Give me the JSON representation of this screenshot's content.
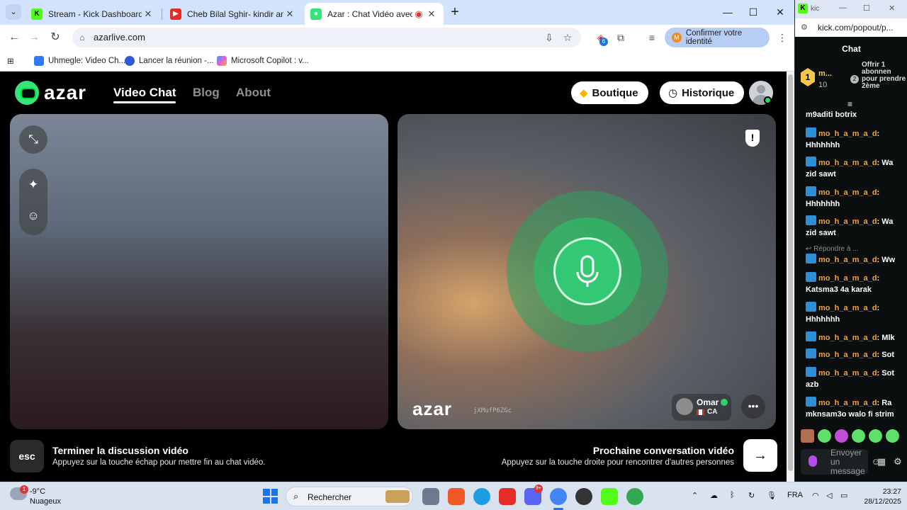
{
  "browser": {
    "tabs": [
      {
        "title": "Stream - Kick Dashboard",
        "favicon": "kick-icon",
        "color": "#53fc18"
      },
      {
        "title": "Cheb Bilal Sghir- kindir ana - Yo",
        "favicon": "youtube-icon",
        "color": "#e52d27"
      },
      {
        "title": "Azar : Chat Vidéo avec de n",
        "favicon": "azar-icon",
        "color": "#33e57b",
        "active": true
      }
    ],
    "url": "azarlive.com",
    "identity_label": "Confirmer votre identité",
    "identity_initial": "M",
    "extension_badge": "6",
    "bookmarks": [
      "Uhmegle: Video Ch...",
      "Lancer la réunion -...",
      "Microsoft Copilot : v..."
    ]
  },
  "azar": {
    "logo_text": "azar",
    "nav": [
      "Video Chat",
      "Blog",
      "About"
    ],
    "boutique_label": "Boutique",
    "historique_label": "Historique",
    "watermark": "azar",
    "watermark_code": "jXMufP6ZGc",
    "peer": {
      "name": "Omar",
      "country": "CA"
    },
    "end_title": "Terminer la discussion vidéo",
    "end_sub": "Appuyez sur la touche échap pour mettre fin au chat vidéo.",
    "esc_key": "esc",
    "next_title": "Prochaine conversation vidéo",
    "next_sub": "Appuyez sur la touche droite pour rencontrer d'autres personnes",
    "accent": "#33c873"
  },
  "kick": {
    "window_title": "kic",
    "url": "kick.com/popout/p...",
    "header": "Chat",
    "gift": {
      "rank": "1",
      "name": "m...",
      "count": "10",
      "text": "Offrir 1 abonnen pour prendre 2ème",
      "badge": "2"
    },
    "messages": [
      {
        "user": "",
        "text": "m9aditi botrix"
      },
      {
        "user": "mo_h_a_m_a_d",
        "text": "Hhhhhhh"
      },
      {
        "user": "mo_h_a_m_a_d",
        "text": "Wa zid sawt"
      },
      {
        "user": "mo_h_a_m_a_d",
        "text": "Hhhhhhh"
      },
      {
        "user": "mo_h_a_m_a_d",
        "text": "Wa zid sawt"
      },
      {
        "user": "mo_h_a_m_a_d",
        "text": "Ww"
      },
      {
        "user": "mo_h_a_m_a_d",
        "text": "Katsma3 4a karak"
      },
      {
        "user": "mo_h_a_m_a_d",
        "text": "Hhhhhhh"
      },
      {
        "user": "mo_h_a_m_a_d",
        "text": "Mlk"
      },
      {
        "user": "mo_h_a_m_a_d",
        "text": "Sot"
      },
      {
        "user": "mo_h_a_m_a_d",
        "text": "Sot azb"
      },
      {
        "user": "mo_h_a_m_a_d",
        "text": "Ra mknsam3o walo fi strim"
      }
    ],
    "reply_label": "Répondre à ...",
    "composer_placeholder": "Envoyer un message"
  },
  "taskbar": {
    "weather_temp": "-9°C",
    "weather_desc": "Nuageux",
    "weather_badge": "1",
    "search_label": "Rechercher",
    "lang": "FRA",
    "time": "23:27",
    "date": "28/12/2025"
  }
}
